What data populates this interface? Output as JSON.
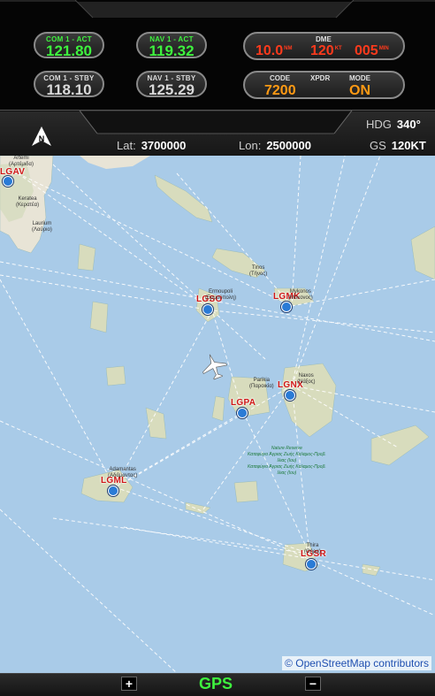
{
  "radios": {
    "com1_act": {
      "label": "COM 1 - ACT",
      "value": "121.80"
    },
    "nav1_act": {
      "label": "NAV 1 - ACT",
      "value": "119.32"
    },
    "com1_stby": {
      "label": "COM 1 - STBY",
      "value": "118.10"
    },
    "nav1_stby": {
      "label": "NAV 1 - STBY",
      "value": "125.29"
    }
  },
  "dme": {
    "label": "DME",
    "distance": "10.0",
    "distance_unit": "NM",
    "speed": "120",
    "speed_unit": "KT",
    "time": "005",
    "time_unit": "MIN"
  },
  "xpdr": {
    "code_label": "CODE",
    "title": "XPDR",
    "mode_label": "MODE",
    "code": "7200",
    "mode": "ON"
  },
  "info": {
    "north_icon": "north-arrow-icon",
    "north_letter": "N",
    "lat_label": "Lat:",
    "lat": "3700000",
    "lon_label": "Lon:",
    "lon": "2500000",
    "hdg_label": "HDG",
    "hdg": "340°",
    "gs_label": "GS",
    "gs": "120KT"
  },
  "airports": [
    {
      "code": "LGAV"
    },
    {
      "code": "LGSO"
    },
    {
      "code": "LGMK"
    },
    {
      "code": "LGPA"
    },
    {
      "code": "LGNX"
    },
    {
      "code": "LGML"
    },
    {
      "code": "LGSR"
    }
  ],
  "places": {
    "artemi": "Artemi\n(Αρτέμιδα)",
    "keratea": "Keratea\n(Κερατέα)",
    "laurium": "Laurium\n(Λαύριο)",
    "tinos": "Tinos\n(Τήνος)",
    "ermoupoli": "Ermoupoli\n(Ερμούπολη)",
    "mykonos": "Mykonos\n(Μύκονος)",
    "parikia": "Parikia\n(Παροικία)",
    "naxos": "Naxos\n(Νάξος)",
    "adamantas": "Adamantas\n(Αδάμαντας)",
    "thira": "Thira\n(Θήρα)",
    "nature": "Nature Reserve\nΚαταφύγιο Άγριας Ζωής Καλαμος-Προβ.\nΙλιας (Ιου)\nΚαταφύγιο Άγριας Ζωής Καλαμος-Προβ.\nΙλιας (Ιου)"
  },
  "credit": "© OpenStreetMap contributors",
  "bottom": {
    "zoom_in": "+",
    "mode": "GPS",
    "zoom_out": "−"
  },
  "colors": {
    "active": "#3ef23e",
    "dme": "#ff3a1c",
    "xpdr": "#ff9a14",
    "sea": "#a9cbe8",
    "airport_code": "#d01616"
  }
}
